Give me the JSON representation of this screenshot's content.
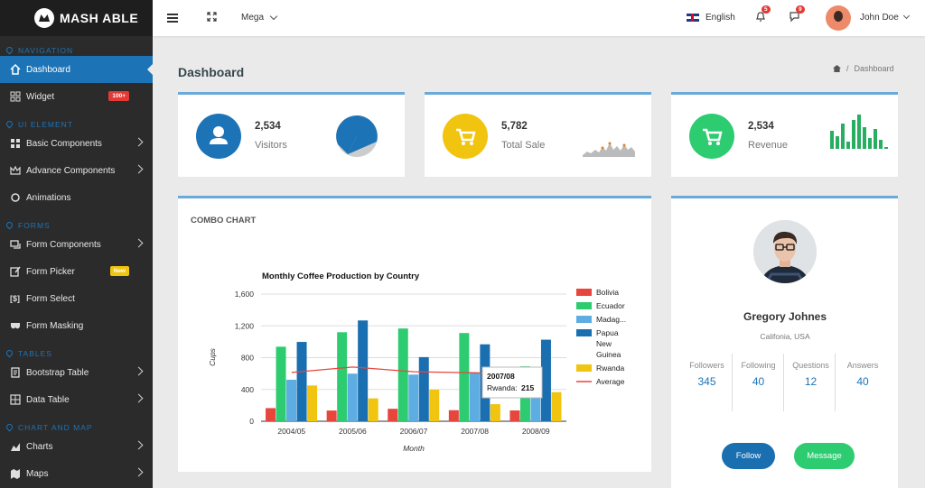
{
  "brand": {
    "name": "MASH ABLE"
  },
  "sidebar": {
    "sections": {
      "navigation": "NAVIGATION",
      "ui_element": "UI ELEMENT",
      "forms": "FORMS",
      "tables": "TABLES",
      "chart_and_map": "CHART AND MAP"
    },
    "items": {
      "dashboard": "Dashboard",
      "widget": "Widget",
      "widget_badge": "100+",
      "basic_components": "Basic Components",
      "advance_components": "Advance Components",
      "animations": "Animations",
      "form_components": "Form Components",
      "form_picker": "Form Picker",
      "form_picker_badge": "New",
      "form_select": "Form Select",
      "form_masking": "Form Masking",
      "bootstrap_table": "Bootstrap Table",
      "data_table": "Data Table",
      "charts": "Charts",
      "maps": "Maps"
    },
    "colors": {
      "bg": "#2b2b2b",
      "active": "#1c74b7",
      "widget_badge": "#e53935",
      "new_badge": "#f1c40f"
    }
  },
  "topbar": {
    "mega": "Mega",
    "language": "English",
    "notifications_count": "5",
    "messages_count": "9",
    "user_name": "John Doe"
  },
  "page": {
    "title": "Dashboard",
    "breadcrumb": "Dashboard"
  },
  "stats": [
    {
      "value": "2,534",
      "label": "Visitors",
      "color": "#1c74b7",
      "icon": "user-icon"
    },
    {
      "value": "5,782",
      "label": "Total Sale",
      "color": "#f1c40f",
      "icon": "cart-icon"
    },
    {
      "value": "2,534",
      "label": "Revenue",
      "color": "#2ecc71",
      "icon": "cart-icon"
    }
  ],
  "combo": {
    "card_title": "COMBO CHART"
  },
  "chart_data": {
    "type": "bar",
    "title": "Monthly Coffee Production by Country",
    "xlabel": "Month",
    "ylabel": "Cups",
    "ylim": [
      0,
      1600
    ],
    "yticks": [
      "0",
      "400",
      "800",
      "1,200",
      "1,600"
    ],
    "categories": [
      "2004/05",
      "2005/06",
      "2006/07",
      "2007/08",
      "2008/09"
    ],
    "series": [
      {
        "name": "Bolivia",
        "values": [
          165,
          135,
          157,
          139,
          136
        ],
        "color": "#e8453c"
      },
      {
        "name": "Ecuador",
        "values": [
          938,
          1120,
          1167,
          1110,
          691
        ],
        "color": "#2ecc71"
      },
      {
        "name": "Madag...",
        "values": [
          522,
          599,
          587,
          615,
          629
        ],
        "color": "#5dade2"
      },
      {
        "name": "Papua New Guinea",
        "values": [
          998,
          1268,
          807,
          968,
          1026
        ],
        "color": "#1a6fb0"
      },
      {
        "name": "Rwanda",
        "values": [
          450,
          288,
          397,
          215,
          366
        ],
        "color": "#f1c40f"
      }
    ],
    "line": {
      "name": "Average",
      "values": [
        614.6,
        682,
        623,
        609.4,
        569.6
      ],
      "color": "#e8453c"
    },
    "legend": "right",
    "tooltip": {
      "category": "2007/08",
      "series": "Rwanda",
      "value": "215"
    }
  },
  "profile": {
    "name": "Gregory Johnes",
    "location": "Califonia, USA",
    "stats": [
      {
        "label": "Followers",
        "value": "345"
      },
      {
        "label": "Following",
        "value": "40"
      },
      {
        "label": "Questions",
        "value": "12"
      },
      {
        "label": "Answers",
        "value": "40"
      }
    ],
    "follow_label": "Follow",
    "message_label": "Message"
  }
}
